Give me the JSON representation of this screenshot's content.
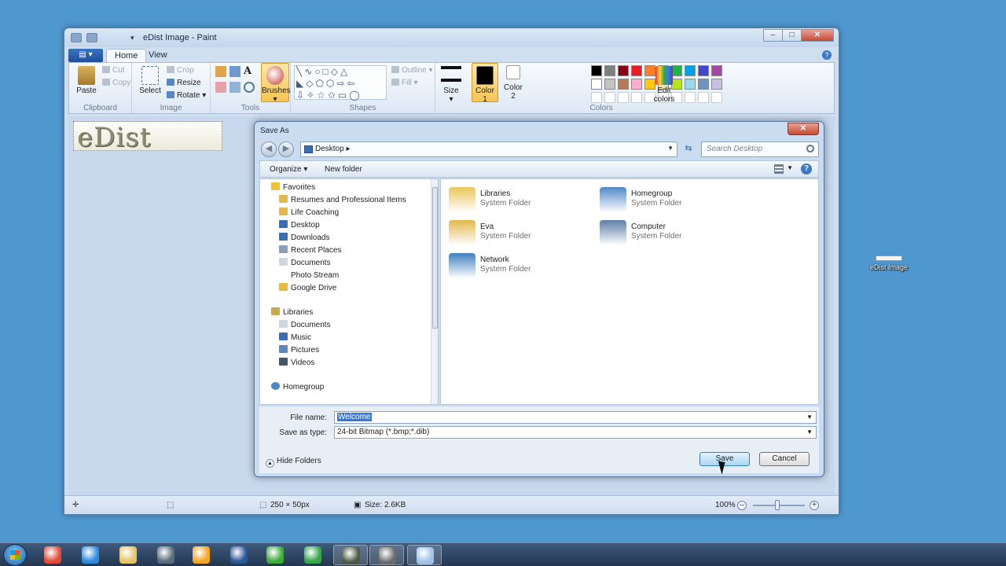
{
  "paint": {
    "title": "eDist Image - Paint",
    "tabs": [
      "Home",
      "View"
    ],
    "file_menu_icon": "menu-icon",
    "ribbon": {
      "clipboard": {
        "label": "Clipboard",
        "paste": "Paste",
        "cut": "Cut",
        "copy": "Copy"
      },
      "image": {
        "label": "Image",
        "select": "Select",
        "crop": "Crop",
        "resize": "Resize",
        "rotate": "Rotate"
      },
      "tools": {
        "label": "Tools",
        "brushes": "Brushes"
      },
      "shapes": {
        "label": "Shapes",
        "outline": "Outline",
        "fill": "Fill"
      },
      "size": {
        "label": "Size"
      },
      "color1": {
        "label": "Color",
        "num": "1"
      },
      "color2": {
        "label": "Color",
        "num": "2"
      },
      "colors": {
        "label": "Colors",
        "edit": "Edit",
        "edit2": "colors"
      }
    },
    "palette_row1": [
      "#000000",
      "#7f7f7f",
      "#880015",
      "#ed1c24",
      "#ff7f27",
      "#fff200",
      "#22b14c",
      "#00a2e8",
      "#3f48cc",
      "#a349a4"
    ],
    "palette_row2": [
      "#ffffff",
      "#c3c3c3",
      "#b97a57",
      "#ffaec9",
      "#ffc90e",
      "#efe4b0",
      "#b5e61d",
      "#99d9ea",
      "#7092be",
      "#c8bfe7"
    ],
    "canvas_text": "eDist",
    "status": {
      "dimensions": "250 × 50px",
      "size": "Size: 2.6KB",
      "zoom": "100%"
    }
  },
  "dialog": {
    "title": "Save As",
    "address": "Desktop",
    "search_placeholder": "Search Desktop",
    "organize": "Organize ▾",
    "new_folder": "New folder",
    "nav": {
      "favorites": "Favorites",
      "favorites_items": [
        "Resumes and Professional Items",
        "Life Coaching",
        "Desktop",
        "Downloads",
        "Recent Places",
        "Documents",
        "Photo Stream",
        "Google Drive"
      ],
      "libraries": "Libraries",
      "libraries_items": [
        "Documents",
        "Music",
        "Pictures",
        "Videos"
      ],
      "homegroup": "Homegroup"
    },
    "files": [
      {
        "name": "Libraries",
        "type": "System Folder",
        "icon": "libraries-icon",
        "color": "#e9c55a"
      },
      {
        "name": "Homegroup",
        "type": "System Folder",
        "icon": "homegroup-icon",
        "color": "#4f88c8"
      },
      {
        "name": "Eva",
        "type": "System Folder",
        "icon": "user-folder-icon",
        "color": "#e3b94c"
      },
      {
        "name": "Computer",
        "type": "System Folder",
        "icon": "computer-icon",
        "color": "#5d7ea6"
      },
      {
        "name": "Network",
        "type": "System Folder",
        "icon": "network-icon",
        "color": "#3f7fc0"
      }
    ],
    "file_name_label": "File name:",
    "file_name_value": "Welcome",
    "save_type_label": "Save as type:",
    "save_type_value": "24-bit Bitmap (*.bmp;*.dib)",
    "hide_folders": "Hide Folders",
    "save": "Save",
    "cancel": "Cancel"
  },
  "desktop_icon": "eDist Image",
  "taskbar": [
    {
      "name": "chrome-icon",
      "color": "#dd4b39"
    },
    {
      "name": "internet-explorer-icon",
      "color": "#2e8bde"
    },
    {
      "name": "file-explorer-icon",
      "color": "#e6c36a"
    },
    {
      "name": "steam-icon",
      "color": "#5b6b7c"
    },
    {
      "name": "media-player-icon",
      "color": "#f5a623"
    },
    {
      "name": "word-icon",
      "color": "#2b5797"
    },
    {
      "name": "download-icon",
      "color": "#3dab3d"
    },
    {
      "name": "utorrent-icon",
      "color": "#35a64a"
    },
    {
      "name": "app-icon",
      "color": "#4b5a44"
    },
    {
      "name": "app-icon-2",
      "color": "#6b6b6b"
    },
    {
      "name": "paint-icon",
      "color": "#9ec3e8"
    }
  ]
}
